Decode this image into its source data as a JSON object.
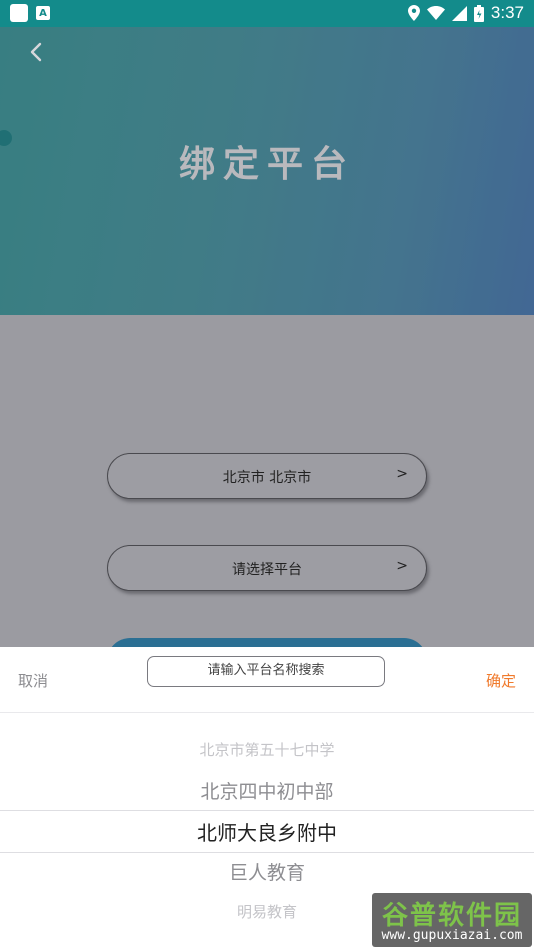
{
  "status_bar": {
    "left_icons": [
      "app-icon",
      "a-icon"
    ],
    "a_label": "A",
    "right_icons": [
      "location-icon",
      "wifi-icon",
      "signal-icon",
      "battery-icon"
    ],
    "time": "3:37"
  },
  "header": {
    "back_icon": "chevron-left-icon",
    "title": "绑定平台",
    "colors": {
      "gradient_start": "#1f7d80",
      "gradient_end": "#2c5e98"
    }
  },
  "form": {
    "city_label": "北京市 北京市",
    "city_chevron": ">",
    "platform_label": "请选择平台",
    "platform_chevron": ">"
  },
  "bottom_sheet": {
    "cancel_label": "取消",
    "confirm_label": "确定",
    "search_placeholder": "请输入平台名称搜索",
    "options": [
      "北京市第五十七中学",
      "北京四中初中部",
      "北师大良乡附中",
      "巨人教育",
      "明易教育"
    ],
    "selected": "北师大良乡附中",
    "colors": {
      "confirm": "#f07a2c"
    }
  },
  "watermark": {
    "name": "谷普软件园",
    "url": "www.gupuxiazai.com"
  }
}
